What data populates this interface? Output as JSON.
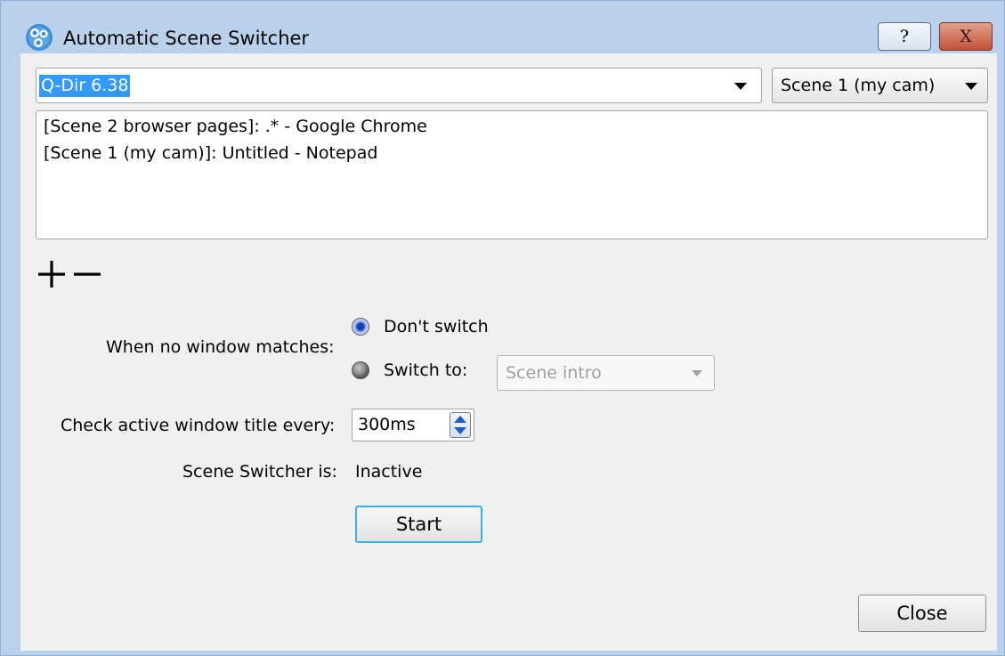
{
  "window": {
    "title": "Automatic Scene Switcher",
    "help_label": "?",
    "close_label": "X"
  },
  "window_select": {
    "value": "Q-Dir 6.38"
  },
  "scene_select": {
    "value": "Scene 1 (my cam)"
  },
  "rules": [
    "[Scene 2 browser pages]: .* - Google Chrome",
    "[Scene 1 (my cam)]: Untitled - Notepad"
  ],
  "no_match": {
    "label": "When no window matches:",
    "dont_switch_label": "Don't switch",
    "switch_to_label": "Switch to:",
    "selected": "dont_switch",
    "switch_scene_value": "Scene intro"
  },
  "check_interval": {
    "label": "Check active window title every:",
    "value": "300ms"
  },
  "status": {
    "label": "Scene Switcher is:",
    "value": "Inactive"
  },
  "buttons": {
    "start": "Start",
    "close": "Close"
  },
  "icons": {
    "app": "obs-logo-icon",
    "add": "plus-icon",
    "remove": "minus-icon"
  }
}
